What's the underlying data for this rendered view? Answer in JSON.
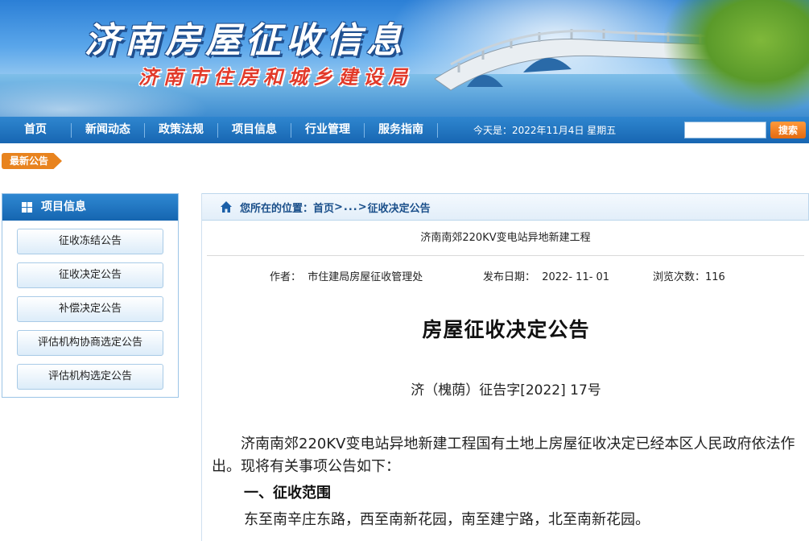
{
  "banner": {
    "title": "济南房屋征收信息",
    "subtitle": "济南市住房和城乡建设局"
  },
  "nav": {
    "items": [
      "首页",
      "新闻动态",
      "政策法规",
      "项目信息",
      "行业管理",
      "服务指南"
    ],
    "date": "今天是：2022年11月4日 星期五",
    "search_placeholder": "",
    "search_button": "搜索"
  },
  "latest": {
    "label": "最新公告"
  },
  "sidebar": {
    "title": "项目信息",
    "items": [
      "征收冻结公告",
      "征收决定公告",
      "补偿决定公告",
      "评估机构协商选定公告",
      "评估机构选定公告"
    ]
  },
  "breadcrumb": {
    "label": "您所在的位置：",
    "home": "首页",
    "sep": ">...>",
    "current": "征收决定公告"
  },
  "article": {
    "project": "济南南郊220KV变电站异地新建工程",
    "author": "作者：  市住建局房屋征收管理处",
    "date": "发布日期：  2022- 11- 01",
    "views": "浏览次数：116",
    "title": "房屋征收决定公告",
    "number": "济（槐荫）征告字[2022] 17号",
    "paragraph": "济南南郊220KV变电站异地新建工程国有土地上房屋征收决定已经本区人民政府依法作出。现将有关事项公告如下：",
    "section1": "一、征收范围",
    "section1_text": "东至南辛庄东路，西至南新花园，南至建宁路，北至南新花园。"
  },
  "colors": {
    "nav_blue": "#1766b2",
    "accent_orange": "#e8831e",
    "crumb_text": "#1a4f8a"
  }
}
